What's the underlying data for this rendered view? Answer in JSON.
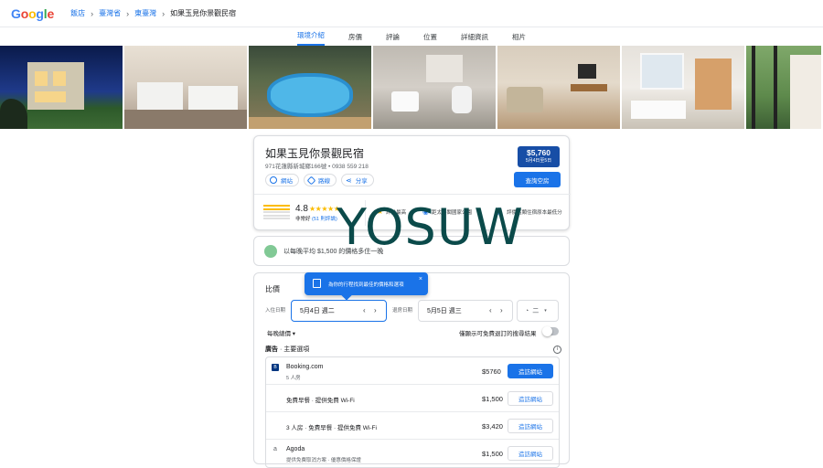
{
  "topbar": {
    "logo_letters": [
      {
        "ch": "G",
        "color": "#4285f4"
      },
      {
        "ch": "o",
        "color": "#ea4335"
      },
      {
        "ch": "o",
        "color": "#fbbc05"
      },
      {
        "ch": "g",
        "color": "#4285f4"
      },
      {
        "ch": "l",
        "color": "#34a853"
      },
      {
        "ch": "e",
        "color": "#ea4335"
      }
    ],
    "breadcrumbs": [
      "飯店",
      "臺灣省",
      "東臺灣",
      "如果玉見你景觀民宿"
    ]
  },
  "tabs": [
    "環境介紹",
    "房價",
    "評論",
    "位置",
    "詳細資訊",
    "相片"
  ],
  "active_tab": "環境介紹",
  "hotel": {
    "name": "如果玉見你景觀民宿",
    "address": "971花蓮縣新城鄉166號 • 0938 559 218",
    "price": "$5,760",
    "dates": "5月4日至5日",
    "check_button": "查詢空房",
    "actions": [
      {
        "label": "網站",
        "icon": "globe-icon"
      },
      {
        "label": "路線",
        "icon": "directions-icon"
      },
      {
        "label": "分享",
        "icon": "share-icon"
      }
    ],
    "rating": "4.8",
    "stars": "★★★★★",
    "rating_label": "非常好",
    "review_count": "(51 則評論)",
    "features": [
      {
        "icon": "★",
        "text": "評分最高",
        "color": "#fbbc04"
      },
      {
        "icon": "◉",
        "text": "距太魯閣國家公園",
        "color": "#1a73e8"
      },
      {
        "icon": "🌡",
        "text": "評價這類住宿原本最低分",
        "color": "#1a73e8"
      }
    ]
  },
  "watermark": "YOSUW",
  "promo": {
    "text": "以每晚平均 $1,500 的價格多住一晚"
  },
  "prices": {
    "title": "比價",
    "tooltip": "為你的行程找到最佳的價格和選項",
    "checkin_label": "入住日期",
    "checkin_value": "5月4日 週二",
    "checkout_label": "退房日期",
    "checkout_value": "5月5日 週三",
    "guests": "二",
    "nightly_label": "每晚總價 ▾",
    "free_cancel_label": "僅顯示可免費退訂的搜尋結果",
    "ads_label": "廣告",
    "ads_sub": " · 主要選項",
    "offers": [
      {
        "provider": "Booking.com",
        "sub": "5 人房",
        "logo": "B",
        "price": "$5760",
        "button": "造訪網站",
        "primary": true
      },
      {
        "provider": "",
        "desc": "免費早餐 · 提供免費 Wi-Fi",
        "price": "$1,500",
        "button": "造訪網站",
        "primary": false
      },
      {
        "provider": "",
        "desc": "3 人房 · 免費早餐 · 提供免費 Wi-Fi",
        "price": "$3,420",
        "button": "造訪網站",
        "primary": false
      },
      {
        "provider": "Agoda",
        "sub": "提供免費取消方案 · 優惠價格保證",
        "logo": "a",
        "price": "$1,500",
        "button": "造訪網站",
        "primary": false
      }
    ]
  },
  "photo_captions": [
    "",
    "",
    "",
    "",
    "",
    "",
    ""
  ]
}
